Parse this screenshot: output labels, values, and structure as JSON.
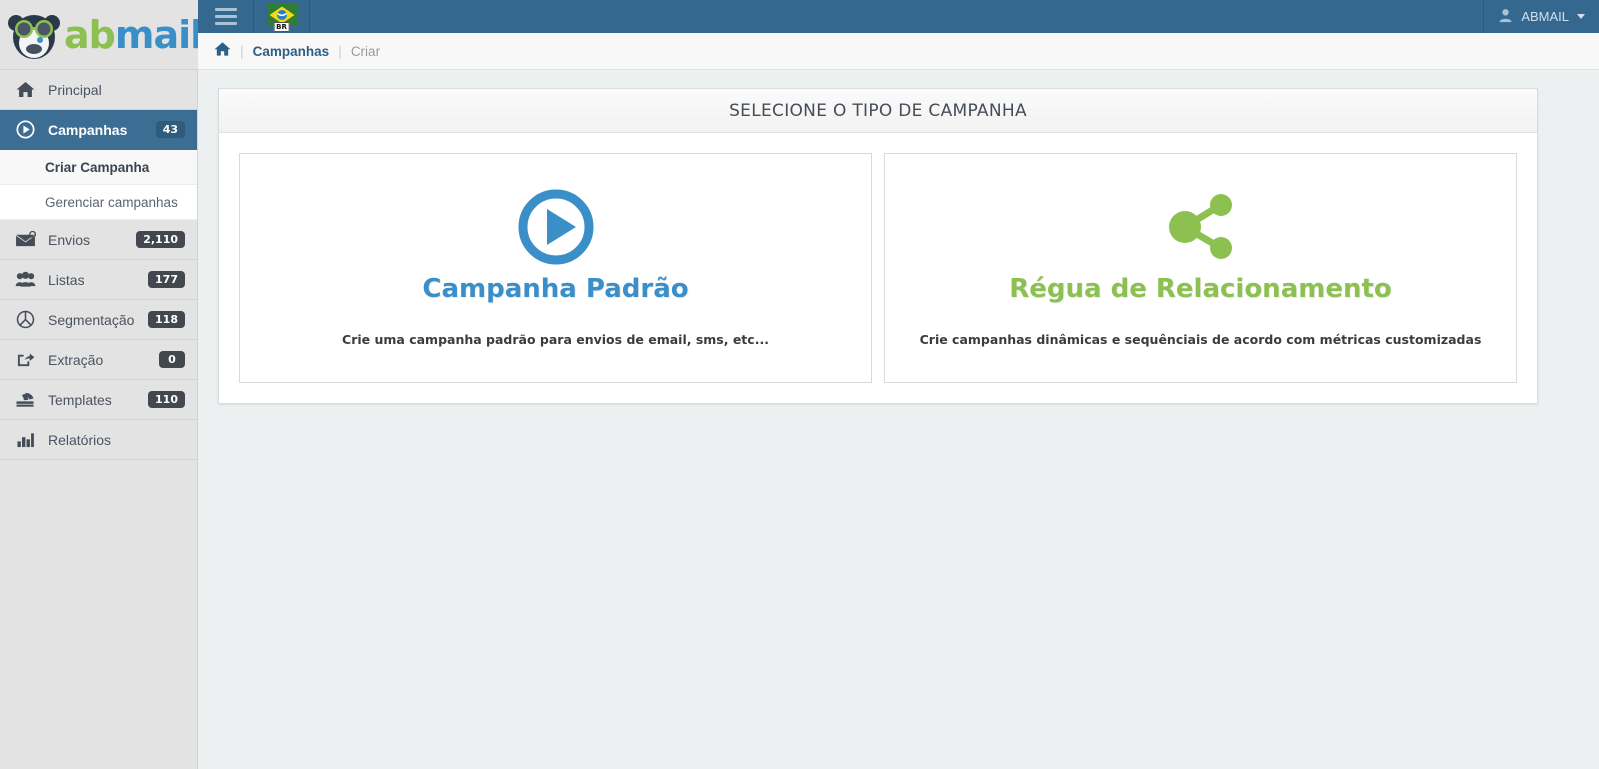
{
  "brand": {
    "name_first": "ab",
    "name_second": "mail",
    "mascot_icon": "panda-glasses-logo",
    "color_first": "#8cc152",
    "color_second": "#3b8fc9"
  },
  "topbar": {
    "menu_toggle_icon": "hamburger-icon",
    "language": {
      "icon": "brazil-flag-icon",
      "tag": "BR"
    },
    "user": {
      "icon": "user-icon",
      "label": "ABMAIL",
      "caret_icon": "caret-down-icon"
    },
    "background": "#34688f"
  },
  "breadcrumb": {
    "home_icon": "home-icon",
    "separator": "|",
    "items": [
      {
        "label": "Campanhas",
        "current": false
      },
      {
        "label": "Criar",
        "current": true
      }
    ]
  },
  "sidebar": {
    "items": [
      {
        "label": "Principal",
        "icon": "home-icon",
        "badge": "",
        "active": false
      },
      {
        "label": "Campanhas",
        "icon": "play-circle-icon",
        "badge": "43",
        "active": true
      },
      {
        "label": "Envios",
        "icon": "envelope-icon",
        "badge": "2,110",
        "active": false
      },
      {
        "label": "Listas",
        "icon": "users-icon",
        "badge": "177",
        "active": false
      },
      {
        "label": "Segmentação",
        "icon": "crosshair-icon",
        "badge": "118",
        "active": false
      },
      {
        "label": "Extração",
        "icon": "share-square-icon",
        "badge": "0",
        "active": false
      },
      {
        "label": "Templates",
        "icon": "layers-icon",
        "badge": "110",
        "active": false
      },
      {
        "label": "Relatórios",
        "icon": "bar-chart-icon",
        "badge": "",
        "active": false
      }
    ],
    "submenu": [
      {
        "label": "Criar Campanha",
        "active": true
      },
      {
        "label": "Gerenciar campanhas",
        "active": false
      }
    ],
    "active_color": "#3c6e94",
    "background": "#e3e3e3"
  },
  "main": {
    "panel_title": "SELECIONE O TIPO DE CAMPANHA",
    "choices": [
      {
        "icon": "play-circle-icon",
        "title": "Campanha Padrão",
        "description": "Crie uma campanha padrão para envios de email, sms, etc...",
        "color": "#3b8fc9"
      },
      {
        "icon": "share-nodes-icon",
        "title": "Régua de Relacionamento",
        "description": "Crie campanhas dinâmicas e sequênciais de acordo com métricas customizadas",
        "color": "#8cc152"
      }
    ]
  }
}
